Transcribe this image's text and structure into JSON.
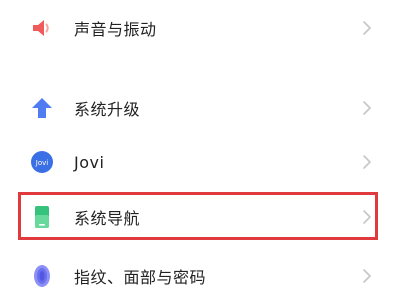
{
  "items": [
    {
      "label": "声音与振动",
      "icon": "speaker-icon",
      "color": "#ef5a5a"
    },
    {
      "label": "系统升级",
      "icon": "arrow-up-icon",
      "color": "#4f7cf0"
    },
    {
      "label": "Jovi",
      "icon": "jovi-icon",
      "color": "#3b6fe6",
      "icon_text": "Jovi"
    },
    {
      "label": "系统导航",
      "icon": "phone-icon",
      "color": "#35c27a"
    },
    {
      "label": "指纹、面部与密码",
      "icon": "fingerprint-icon",
      "color": "#6a6ff0"
    }
  ],
  "highlight_color": "#e0393e"
}
